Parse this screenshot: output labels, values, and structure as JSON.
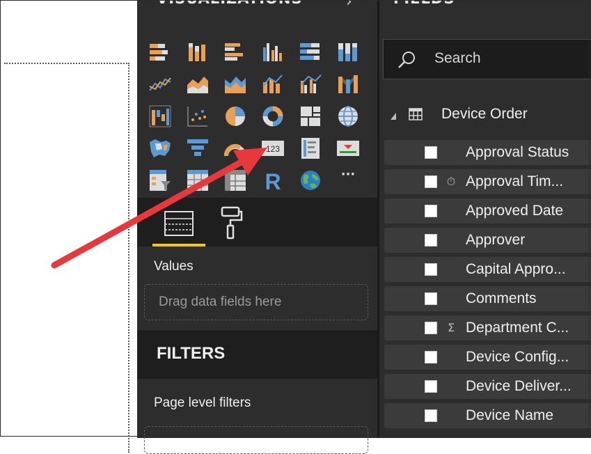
{
  "visualizations": {
    "title": "VISUALIZATIONS",
    "chevron": "›",
    "icons": [
      "stacked-bar-chart-icon",
      "stacked-column-chart-icon",
      "clustered-bar-chart-icon",
      "clustered-column-chart-icon",
      "100-stacked-bar-chart-icon",
      "100-stacked-column-chart-icon",
      "line-chart-icon",
      "area-chart-icon",
      "stacked-area-chart-icon",
      "line-and-stacked-column-icon",
      "line-and-clustered-column-icon",
      "ribbon-chart-icon",
      "waterfall-chart-icon",
      "scatter-chart-icon",
      "pie-chart-icon",
      "donut-chart-icon",
      "treemap-icon",
      "map-icon",
      "filled-map-icon",
      "funnel-icon",
      "gauge-icon",
      "card-icon",
      "multi-row-card-icon",
      "kpi-icon",
      "slicer-icon",
      "table-icon",
      "matrix-icon",
      "r-visual-icon",
      "arcgis-map-icon",
      "more-visuals-icon"
    ],
    "r_label": "R",
    "card_label": "123",
    "more_label": "···"
  },
  "format_tabs": {
    "fields_tab": "fields-tab",
    "format_tab": "format-tab"
  },
  "values": {
    "label": "Values",
    "placeholder": "Drag data fields here"
  },
  "filters": {
    "title": "FILTERS",
    "page_level_label": "Page level filters"
  },
  "fields": {
    "title": "FIELDS",
    "search_placeholder": "Search",
    "table": {
      "name": "Device Order",
      "items": [
        {
          "label": "Approval Status",
          "type": ""
        },
        {
          "label": "Approval Tim...",
          "type": "⏱"
        },
        {
          "label": "Approved Date",
          "type": ""
        },
        {
          "label": "Approver",
          "type": ""
        },
        {
          "label": "Capital Appro...",
          "type": ""
        },
        {
          "label": "Comments",
          "type": ""
        },
        {
          "label": "Department C...",
          "type": "Σ"
        },
        {
          "label": "Device Config...",
          "type": ""
        },
        {
          "label": "Device Deliver...",
          "type": ""
        },
        {
          "label": "Device Name",
          "type": ""
        }
      ]
    }
  },
  "colors": {
    "accent_yellow": "#f2c811",
    "arrow_red": "#e8383b",
    "orange": "#e8a055",
    "blue": "#5b9bd5",
    "pane_bg": "#2d2d2d"
  }
}
